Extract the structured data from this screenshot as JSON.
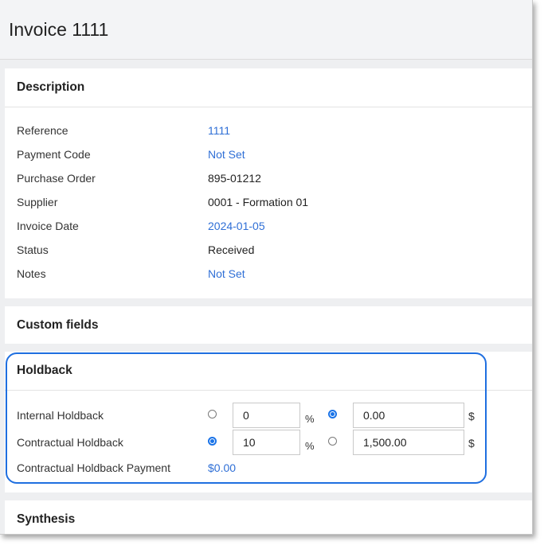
{
  "page": {
    "title": "Invoice 1111"
  },
  "description": {
    "title": "Description",
    "rows": [
      {
        "label": "Reference",
        "value": "1111"
      },
      {
        "label": "Payment Code",
        "value": "Not Set"
      },
      {
        "label": "Purchase Order",
        "value": "895-01212"
      },
      {
        "label": "Supplier",
        "value": "0001 - Formation 01"
      },
      {
        "label": "Invoice Date",
        "value": "2024-01-05"
      },
      {
        "label": "Status",
        "value": "Received"
      },
      {
        "label": "Notes",
        "value": "Not Set"
      }
    ]
  },
  "custom_fields": {
    "title": "Custom fields"
  },
  "holdback": {
    "title": "Holdback",
    "internal": {
      "label": "Internal Holdback",
      "percent": "0",
      "percent_unit": "%",
      "amount": "0.00",
      "amount_unit": "$",
      "selected": "amount"
    },
    "contractual": {
      "label": "Contractual Holdback",
      "percent": "10",
      "percent_unit": "%",
      "amount": "1,500.00",
      "amount_unit": "$",
      "selected": "percent"
    },
    "payment": {
      "label": "Contractual Holdback Payment",
      "value": "$0.00"
    }
  },
  "synthesis": {
    "title": "Synthesis"
  },
  "colors": {
    "link": "#2f6fd6",
    "accent": "#1a73e8",
    "highlight": "#1f6fe0"
  }
}
